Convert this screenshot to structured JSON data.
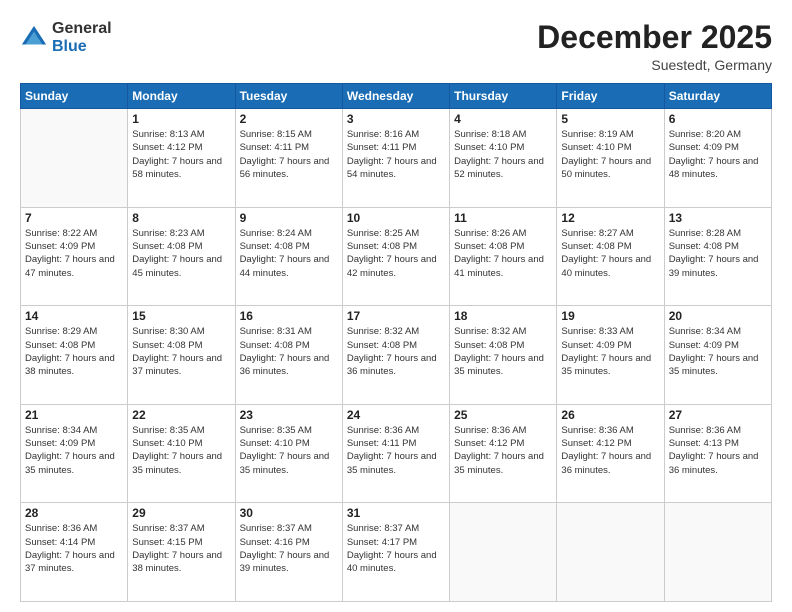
{
  "header": {
    "logo_general": "General",
    "logo_blue": "Blue",
    "month_title": "December 2025",
    "subtitle": "Suestedt, Germany"
  },
  "days_of_week": [
    "Sunday",
    "Monday",
    "Tuesday",
    "Wednesday",
    "Thursday",
    "Friday",
    "Saturday"
  ],
  "weeks": [
    [
      {
        "day": "",
        "sunrise": "",
        "sunset": "",
        "daylight": ""
      },
      {
        "day": "1",
        "sunrise": "Sunrise: 8:13 AM",
        "sunset": "Sunset: 4:12 PM",
        "daylight": "Daylight: 7 hours and 58 minutes."
      },
      {
        "day": "2",
        "sunrise": "Sunrise: 8:15 AM",
        "sunset": "Sunset: 4:11 PM",
        "daylight": "Daylight: 7 hours and 56 minutes."
      },
      {
        "day": "3",
        "sunrise": "Sunrise: 8:16 AM",
        "sunset": "Sunset: 4:11 PM",
        "daylight": "Daylight: 7 hours and 54 minutes."
      },
      {
        "day": "4",
        "sunrise": "Sunrise: 8:18 AM",
        "sunset": "Sunset: 4:10 PM",
        "daylight": "Daylight: 7 hours and 52 minutes."
      },
      {
        "day": "5",
        "sunrise": "Sunrise: 8:19 AM",
        "sunset": "Sunset: 4:10 PM",
        "daylight": "Daylight: 7 hours and 50 minutes."
      },
      {
        "day": "6",
        "sunrise": "Sunrise: 8:20 AM",
        "sunset": "Sunset: 4:09 PM",
        "daylight": "Daylight: 7 hours and 48 minutes."
      }
    ],
    [
      {
        "day": "7",
        "sunrise": "Sunrise: 8:22 AM",
        "sunset": "Sunset: 4:09 PM",
        "daylight": "Daylight: 7 hours and 47 minutes."
      },
      {
        "day": "8",
        "sunrise": "Sunrise: 8:23 AM",
        "sunset": "Sunset: 4:08 PM",
        "daylight": "Daylight: 7 hours and 45 minutes."
      },
      {
        "day": "9",
        "sunrise": "Sunrise: 8:24 AM",
        "sunset": "Sunset: 4:08 PM",
        "daylight": "Daylight: 7 hours and 44 minutes."
      },
      {
        "day": "10",
        "sunrise": "Sunrise: 8:25 AM",
        "sunset": "Sunset: 4:08 PM",
        "daylight": "Daylight: 7 hours and 42 minutes."
      },
      {
        "day": "11",
        "sunrise": "Sunrise: 8:26 AM",
        "sunset": "Sunset: 4:08 PM",
        "daylight": "Daylight: 7 hours and 41 minutes."
      },
      {
        "day": "12",
        "sunrise": "Sunrise: 8:27 AM",
        "sunset": "Sunset: 4:08 PM",
        "daylight": "Daylight: 7 hours and 40 minutes."
      },
      {
        "day": "13",
        "sunrise": "Sunrise: 8:28 AM",
        "sunset": "Sunset: 4:08 PM",
        "daylight": "Daylight: 7 hours and 39 minutes."
      }
    ],
    [
      {
        "day": "14",
        "sunrise": "Sunrise: 8:29 AM",
        "sunset": "Sunset: 4:08 PM",
        "daylight": "Daylight: 7 hours and 38 minutes."
      },
      {
        "day": "15",
        "sunrise": "Sunrise: 8:30 AM",
        "sunset": "Sunset: 4:08 PM",
        "daylight": "Daylight: 7 hours and 37 minutes."
      },
      {
        "day": "16",
        "sunrise": "Sunrise: 8:31 AM",
        "sunset": "Sunset: 4:08 PM",
        "daylight": "Daylight: 7 hours and 36 minutes."
      },
      {
        "day": "17",
        "sunrise": "Sunrise: 8:32 AM",
        "sunset": "Sunset: 4:08 PM",
        "daylight": "Daylight: 7 hours and 36 minutes."
      },
      {
        "day": "18",
        "sunrise": "Sunrise: 8:32 AM",
        "sunset": "Sunset: 4:08 PM",
        "daylight": "Daylight: 7 hours and 35 minutes."
      },
      {
        "day": "19",
        "sunrise": "Sunrise: 8:33 AM",
        "sunset": "Sunset: 4:09 PM",
        "daylight": "Daylight: 7 hours and 35 minutes."
      },
      {
        "day": "20",
        "sunrise": "Sunrise: 8:34 AM",
        "sunset": "Sunset: 4:09 PM",
        "daylight": "Daylight: 7 hours and 35 minutes."
      }
    ],
    [
      {
        "day": "21",
        "sunrise": "Sunrise: 8:34 AM",
        "sunset": "Sunset: 4:09 PM",
        "daylight": "Daylight: 7 hours and 35 minutes."
      },
      {
        "day": "22",
        "sunrise": "Sunrise: 8:35 AM",
        "sunset": "Sunset: 4:10 PM",
        "daylight": "Daylight: 7 hours and 35 minutes."
      },
      {
        "day": "23",
        "sunrise": "Sunrise: 8:35 AM",
        "sunset": "Sunset: 4:10 PM",
        "daylight": "Daylight: 7 hours and 35 minutes."
      },
      {
        "day": "24",
        "sunrise": "Sunrise: 8:36 AM",
        "sunset": "Sunset: 4:11 PM",
        "daylight": "Daylight: 7 hours and 35 minutes."
      },
      {
        "day": "25",
        "sunrise": "Sunrise: 8:36 AM",
        "sunset": "Sunset: 4:12 PM",
        "daylight": "Daylight: 7 hours and 35 minutes."
      },
      {
        "day": "26",
        "sunrise": "Sunrise: 8:36 AM",
        "sunset": "Sunset: 4:12 PM",
        "daylight": "Daylight: 7 hours and 36 minutes."
      },
      {
        "day": "27",
        "sunrise": "Sunrise: 8:36 AM",
        "sunset": "Sunset: 4:13 PM",
        "daylight": "Daylight: 7 hours and 36 minutes."
      }
    ],
    [
      {
        "day": "28",
        "sunrise": "Sunrise: 8:36 AM",
        "sunset": "Sunset: 4:14 PM",
        "daylight": "Daylight: 7 hours and 37 minutes."
      },
      {
        "day": "29",
        "sunrise": "Sunrise: 8:37 AM",
        "sunset": "Sunset: 4:15 PM",
        "daylight": "Daylight: 7 hours and 38 minutes."
      },
      {
        "day": "30",
        "sunrise": "Sunrise: 8:37 AM",
        "sunset": "Sunset: 4:16 PM",
        "daylight": "Daylight: 7 hours and 39 minutes."
      },
      {
        "day": "31",
        "sunrise": "Sunrise: 8:37 AM",
        "sunset": "Sunset: 4:17 PM",
        "daylight": "Daylight: 7 hours and 40 minutes."
      },
      {
        "day": "",
        "sunrise": "",
        "sunset": "",
        "daylight": ""
      },
      {
        "day": "",
        "sunrise": "",
        "sunset": "",
        "daylight": ""
      },
      {
        "day": "",
        "sunrise": "",
        "sunset": "",
        "daylight": ""
      }
    ]
  ]
}
